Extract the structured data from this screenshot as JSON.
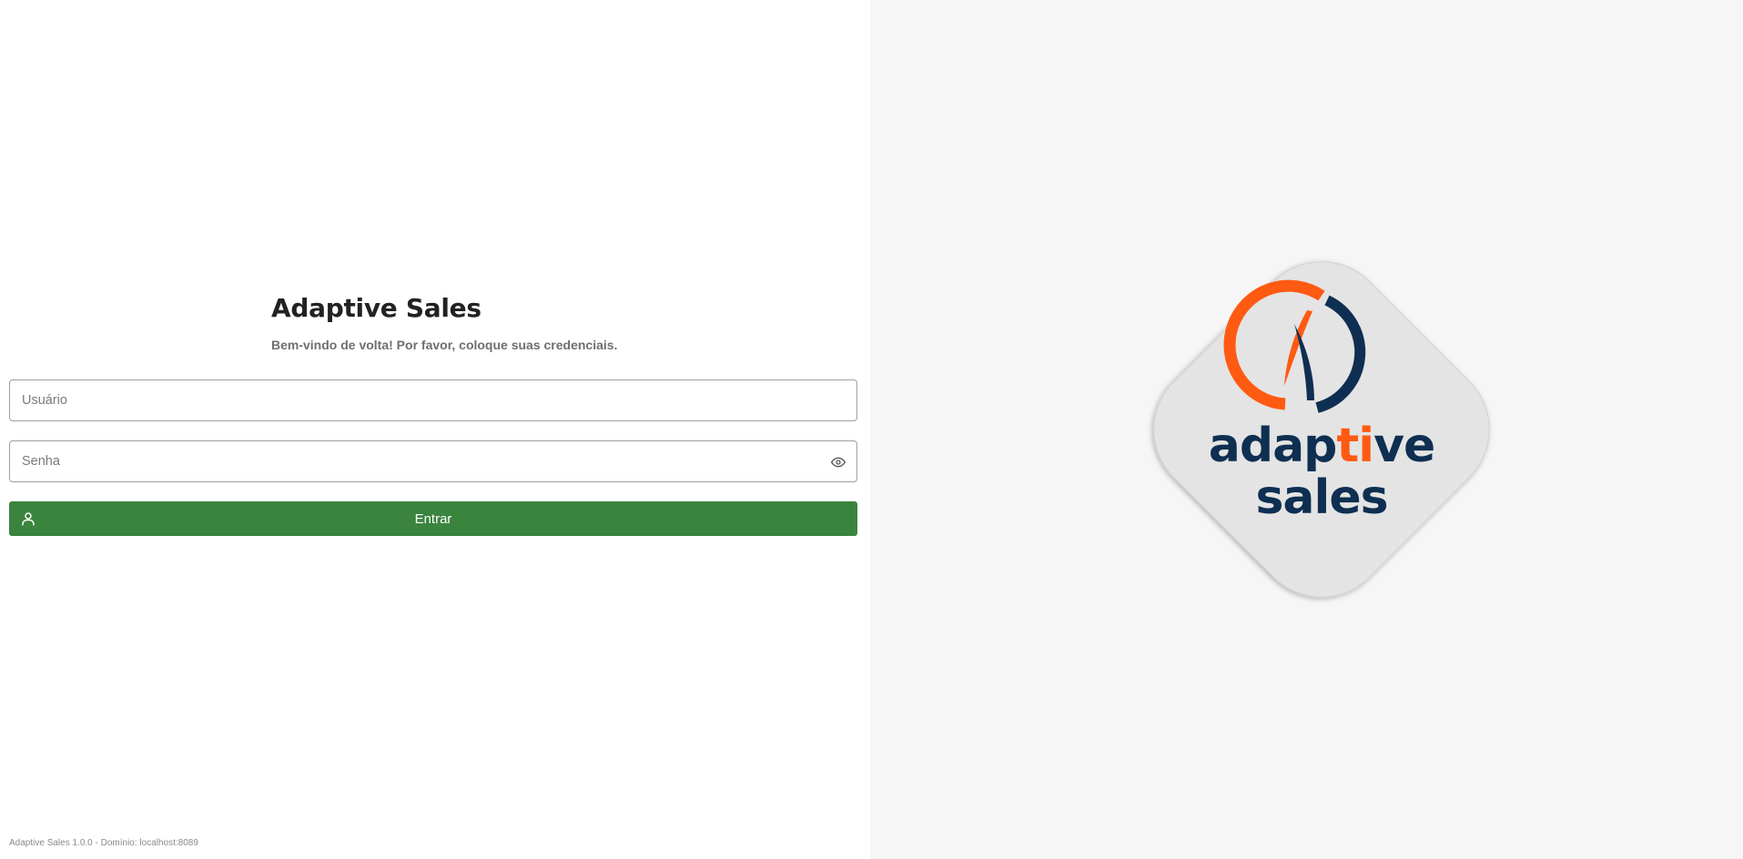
{
  "app": {
    "title": "Adaptive Sales",
    "subtitle": "Bem-vindo de volta! Por favor, coloque suas credenciais."
  },
  "form": {
    "username_placeholder": "Usuário",
    "username_value": "",
    "password_placeholder": "Senha",
    "password_value": "",
    "password_toggle_icon": "eye-icon",
    "submit_label": "Entrar",
    "submit_icon": "user-icon"
  },
  "footer": {
    "text": "Adaptive Sales 1.0.0 - Domínio: localhost:8089"
  },
  "logo": {
    "word1_part1": "adap",
    "word1_highlight": "ti",
    "word1_part2": "ve",
    "word2": "sales"
  },
  "colors": {
    "primary_button": "#3a843e",
    "brand_orange": "#ff5a12",
    "brand_navy": "#0e2f52",
    "logo_tile": "#e4e4e4",
    "right_panel_bg": "#f6f6f6"
  }
}
